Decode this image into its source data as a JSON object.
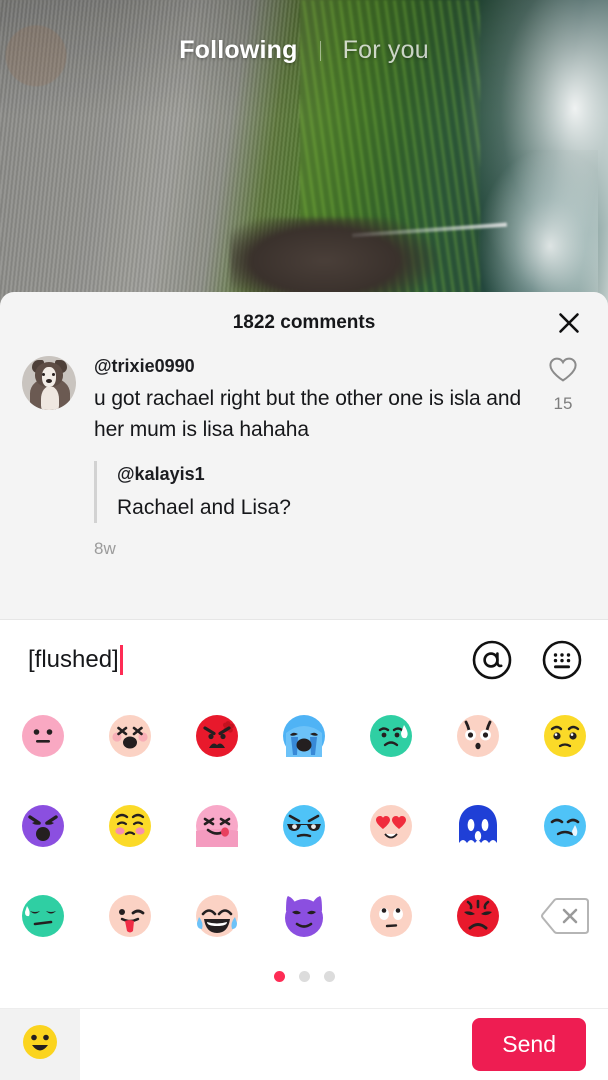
{
  "feed": {
    "tabs": [
      {
        "label": "Following",
        "active": true
      },
      {
        "label": "For you",
        "active": false
      }
    ]
  },
  "comments_sheet": {
    "title": "1822 comments",
    "close_label": "✕",
    "comment": {
      "username": "@trixie0990",
      "text": "u got rachael right but the other one is isla and her mum is lisa hahaha",
      "timestamp": "8w",
      "like_count": "15",
      "avatar_name": "dog-profile-photo",
      "quoted_reply": {
        "username": "@kalayis1",
        "text": "Rachael and Lisa?"
      }
    }
  },
  "emoji_keyboard": {
    "input_value": "[flushed]",
    "mention_icon": "at-sign-icon",
    "keyboard_icon": "keyboard-icon",
    "pages": {
      "count": 3,
      "active_index": 0
    },
    "emojis": [
      {
        "name": "neutral-face",
        "face": "pink-neutral"
      },
      {
        "name": "weary-crying-face",
        "face": "peach-weary"
      },
      {
        "name": "angry-face",
        "face": "red-angry"
      },
      {
        "name": "loudly-crying-face",
        "face": "blue-sobbing"
      },
      {
        "name": "anxious-sweat-face",
        "face": "teal-sweat"
      },
      {
        "name": "flushed-face",
        "face": "peach-shocked"
      },
      {
        "name": "pleading-face",
        "face": "yellow-pleading"
      },
      {
        "name": "rage-face",
        "face": "purple-rage"
      },
      {
        "name": "sad-pleading-face",
        "face": "yellow-sad-blush"
      },
      {
        "name": "silly-tongue-face",
        "face": "pink-tongue"
      },
      {
        "name": "cool-sunglasses-face",
        "face": "blue-sunglasses"
      },
      {
        "name": "heart-eyes-face",
        "face": "peach-heart-eyes"
      },
      {
        "name": "screaming-face",
        "face": "blue-scream"
      },
      {
        "name": "crying-face",
        "face": "blue-tear"
      },
      {
        "name": "unamused-sweat-face",
        "face": "teal-unamused"
      },
      {
        "name": "winking-tongue-face",
        "face": "peach-wink-tongue"
      },
      {
        "name": "joy-laughing-face",
        "face": "peach-joy"
      },
      {
        "name": "devil-face",
        "face": "purple-devil"
      },
      {
        "name": "eye-roll-face",
        "face": "peach-eyeroll"
      },
      {
        "name": "furious-face",
        "face": "red-furious"
      },
      {
        "name": "backspace-key",
        "face": "backspace"
      }
    ]
  },
  "bottom_bar": {
    "emoji_tab_icon": "smiley-icon",
    "send_label": "Send",
    "send_color": "#ee1d52"
  }
}
